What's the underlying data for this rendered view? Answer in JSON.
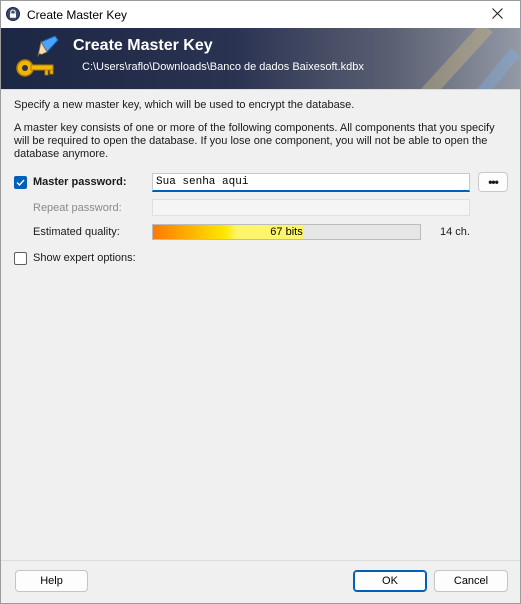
{
  "window": {
    "title": "Create Master Key"
  },
  "banner": {
    "title": "Create Master Key",
    "path": "C:\\Users\\raflo\\Downloads\\Banco de dados Baixesoft.kdbx"
  },
  "intro": {
    "line1": "Specify a new master key, which will be used to encrypt the database.",
    "line2": "A master key consists of one or more of the following components. All components that you specify will be required to open the database. If you lose one component, you will not be able to open the database anymore."
  },
  "master_password": {
    "checked": true,
    "label": "Master password:",
    "value": "Sua senha aqui",
    "reveal_button": "•••"
  },
  "repeat_password": {
    "label": "Repeat password:",
    "value": ""
  },
  "quality": {
    "label": "Estimated quality:",
    "bits_text": "67 bits",
    "fill_fraction": 0.56,
    "chars_text": "14 ch."
  },
  "expert_options": {
    "checked": false,
    "label": "Show expert options:"
  },
  "buttons": {
    "help": "Help",
    "ok": "OK",
    "cancel": "Cancel"
  },
  "colors": {
    "accent": "#005fb8",
    "banner_dark": "#1c2744",
    "quality_start": "#ff7a00",
    "quality_end": "#fff56a"
  }
}
